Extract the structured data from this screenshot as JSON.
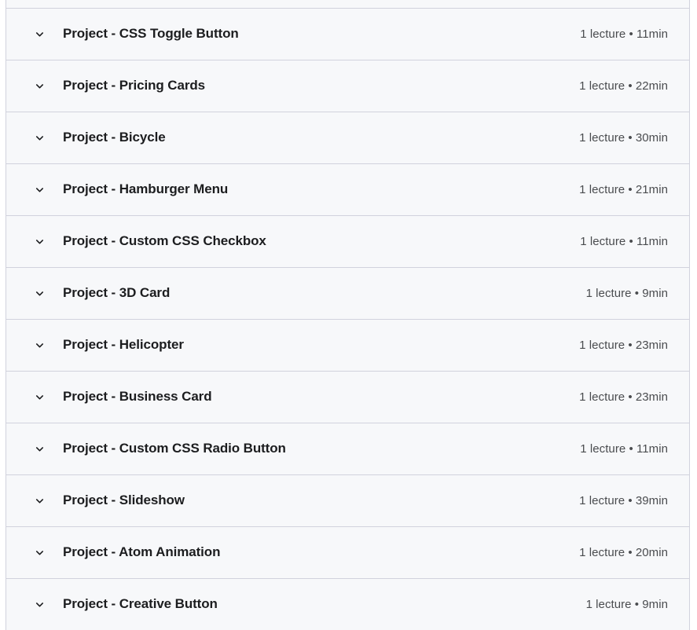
{
  "panel": {
    "background_color": "#f7f8fa",
    "border_color": "#d1d2dd",
    "title_color": "#1c1d1f",
    "meta_color": "#4a4c4f",
    "expand_icon": "chevron-down-icon"
  },
  "sections": [
    {
      "title": "Project - CSS Toggle Button",
      "meta": "1 lecture • 11min"
    },
    {
      "title": "Project - Pricing Cards",
      "meta": "1 lecture • 22min"
    },
    {
      "title": "Project - Bicycle",
      "meta": "1 lecture • 30min"
    },
    {
      "title": "Project - Hamburger Menu",
      "meta": "1 lecture • 21min"
    },
    {
      "title": "Project - Custom CSS Checkbox",
      "meta": "1 lecture • 11min"
    },
    {
      "title": "Project - 3D Card",
      "meta": "1 lecture • 9min"
    },
    {
      "title": "Project - Helicopter",
      "meta": "1 lecture • 23min"
    },
    {
      "title": "Project - Business Card",
      "meta": "1 lecture • 23min"
    },
    {
      "title": "Project - Custom CSS Radio Button",
      "meta": "1 lecture • 11min"
    },
    {
      "title": "Project - Slideshow",
      "meta": "1 lecture • 39min"
    },
    {
      "title": "Project - Atom Animation",
      "meta": "1 lecture • 20min"
    },
    {
      "title": "Project - Creative Button",
      "meta": "1 lecture • 9min"
    }
  ],
  "partial_top_section": {
    "title": "",
    "meta": ""
  }
}
